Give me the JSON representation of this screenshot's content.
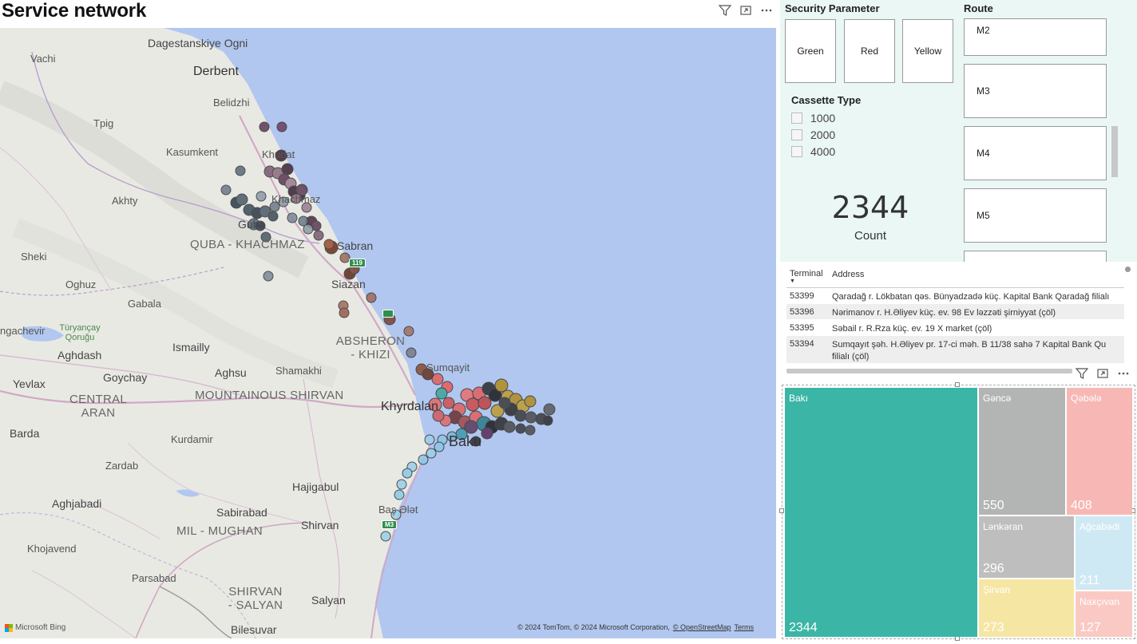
{
  "page": {
    "title": "Service network"
  },
  "map": {
    "labels": {
      "dagestanskiye": "Dagestanskiye Ogni",
      "vachi": "Vachi",
      "derbent": "Derbent",
      "belidzhi": "Belidzhi",
      "tpig": "Tpig",
      "kasumkent": "Kasumkent",
      "khachmaz_a": "Khudat",
      "khachmaz_b": "Khachmaz",
      "akhty": "Akhty",
      "guba": "Guba",
      "quba_region": "QUBA - KHACHMAZ",
      "sabran": "Sabran",
      "sheki": "Sheki",
      "oghuz": "Oghuz",
      "siazan": "Siazan",
      "gabala": "Gabala",
      "mingachevir": "ngachevir",
      "turyancay": "Türyançay Qoruğu",
      "aghdash": "Aghdash",
      "ismailly": "Ismailly",
      "absheron": "ABSHERON - KHIZI",
      "goychay": "Goychay",
      "aghsu": "Aghsu",
      "shamakhi": "Shamakhi",
      "sumqayit": "Sumqayit",
      "yevlax": "Yevlax",
      "central_aran": "CENTRAL ARAN",
      "mountainous": "MOUNTAINOUS SHIRVAN",
      "khyrdalan": "Khyrdalan",
      "baku": "Baku",
      "barda": "Barda",
      "kurdamir": "Kurdamir",
      "zardab": "Zardab",
      "hajigabul": "Hajigabul",
      "aghjabadi": "Aghjabadi",
      "sabirabad": "Sabirabad",
      "mil_mughan": "MIL - MUGHAN",
      "shirvan": "Shirvan",
      "basbalat": "Baş Ələt",
      "khojavend": "Khojavend",
      "parsabad": "Parsabad",
      "shirvan_salyan": "SHIRVAN - SALYAN",
      "salyan": "Salyan",
      "bilesuvar": "Bilesuvar"
    },
    "shields": [
      "119",
      "M3"
    ],
    "bing": "Microsoft Bing",
    "attribution": "© 2024 TomTom, © 2024 Microsoft Corporation,",
    "osm": "© OpenStreetMap",
    "terms": "Terms"
  },
  "security": {
    "title": "Security Parameter",
    "options": [
      "Green",
      "Red",
      "Yellow"
    ]
  },
  "cassette": {
    "title": "Cassette Type",
    "options": [
      "1000",
      "2000",
      "4000"
    ]
  },
  "card": {
    "value": "2344",
    "label": "Count"
  },
  "route": {
    "title": "Route",
    "items": [
      "M2",
      "M3",
      "M4",
      "M5",
      ""
    ]
  },
  "table": {
    "headers": [
      "Terminal",
      "Address"
    ],
    "rows": [
      {
        "terminal": "53399",
        "address": "Qaradağ r. Lökbatan qəs. Bünyadzadə küç. Kapital Bank Qaradağ filialı"
      },
      {
        "terminal": "53396",
        "address": "Nərimanov r. H.Əliyev küç. ev. 98 Ev ləzzəti şirniyyat (çöl)"
      },
      {
        "terminal": "53395",
        "address": "Səbail r. R.Rza küç. ev. 19 X market (çöl)"
      },
      {
        "terminal": "53394",
        "address": "Sumqayıt şəh. H.Əliyev pr. 17-ci məh. B 11/38 sahə 7 Kapital Bank Qu filialı (çöl)"
      }
    ]
  },
  "treemap": {
    "cells": [
      {
        "name": "Bakı",
        "value": "2344",
        "color": "#3ab5a6"
      },
      {
        "name": "Gəncə",
        "value": "550",
        "color": "#b3b5b4"
      },
      {
        "name": "Qəbələ",
        "value": "408",
        "color": "#f7b7b4"
      },
      {
        "name": "Lənkəran",
        "value": "296",
        "color": "#bdbebd"
      },
      {
        "name": "Ağcabədi",
        "value": "211",
        "color": "#cfe9f4"
      },
      {
        "name": "Şirvan",
        "value": "273",
        "color": "#f6e6a4"
      },
      {
        "name": "Naxçıvan",
        "value": "127",
        "color": "#fac9c4"
      }
    ]
  },
  "colors": {
    "sea": "#b1c7ef",
    "land": "#e9e9e4",
    "accent": "#3ab5a6"
  }
}
